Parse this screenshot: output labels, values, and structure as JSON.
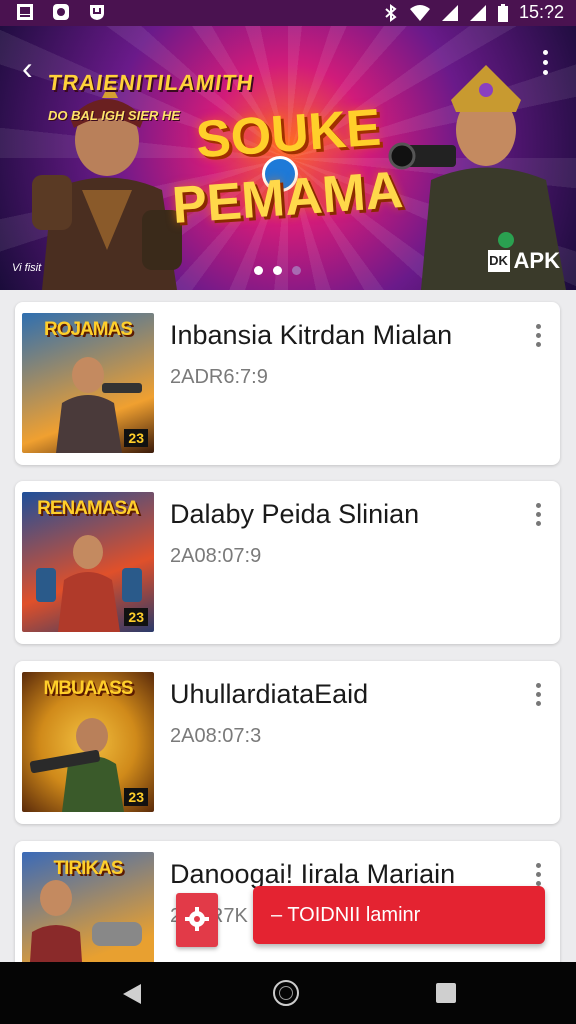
{
  "status_bar": {
    "time": "15:?2"
  },
  "hero": {
    "back_glyph": "‹",
    "subtitle_1": "TRAIENITILAMITH",
    "subtitle_2": "DO BAL IGH SIER HE",
    "title_line_1": "SOUKE",
    "title_line_2": "PEMAMA",
    "watermark": "Vi fisit",
    "apk_icon": "DK",
    "apk_label": "APK",
    "dots": 3,
    "active_dot": 1
  },
  "posts": [
    {
      "thumb_title": "ROJAMAS",
      "thumb_num": "23",
      "title": "Inbansia Kitrdan Mialan",
      "date": "2ADR6:7:9",
      "thumb_colors": [
        "#2f6fb0",
        "#f0a030"
      ]
    },
    {
      "thumb_title": "RENAMASA",
      "thumb_num": "23",
      "title": "Dalaby Peida Slinian",
      "date": "2A08:07:9",
      "thumb_colors": [
        "#1e4f9a",
        "#e0502a"
      ]
    },
    {
      "thumb_title": "MBUAASS",
      "thumb_num": "23",
      "title": "UhullardiataEaid",
      "date": "2A08:07:3",
      "thumb_colors": [
        "#d08a1a",
        "#f2c040"
      ]
    },
    {
      "thumb_title": "TIRIKAS",
      "thumb_num": "",
      "title": "Danoogai! Iirala Mariain",
      "date": "2DAR7K",
      "thumb_colors": [
        "#3a6ab8",
        "#e8a030"
      ]
    }
  ],
  "fab": {
    "label": "– TOIDNII laminr"
  },
  "colors": {
    "accent": "#e42331",
    "status_bar": "#4a1250",
    "nav_bar": "#050505"
  }
}
